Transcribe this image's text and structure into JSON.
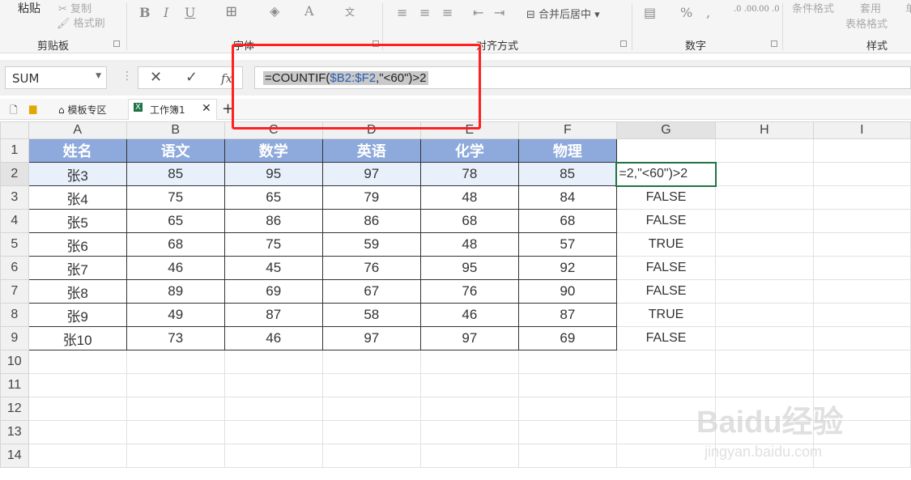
{
  "ribbon": {
    "paste": "粘贴",
    "copy": "复制",
    "format_painter": "格式刷",
    "merge_center": "合并后居中",
    "cond_format": "条件格式",
    "apply_table": "套用",
    "table_format": "表格格式",
    "single": "单",
    "groups": {
      "clipboard": "剪贴板",
      "font": "字体",
      "alignment": "对齐方式",
      "number": "数字",
      "styles": "样式"
    }
  },
  "formula_bar": {
    "name_box": "SUM",
    "formula_prefix": "=COUNTIF(",
    "formula_ref": "$B2:$F2",
    "formula_suffix": ",\"<60\")>2"
  },
  "tabs": {
    "template_zone": "模板专区",
    "workbook": "工作簿1",
    "add": "+"
  },
  "columns": [
    "A",
    "B",
    "C",
    "D",
    "E",
    "F",
    "G",
    "H",
    "I"
  ],
  "rows": [
    "1",
    "2",
    "3",
    "4",
    "5",
    "6",
    "7",
    "8",
    "9",
    "10",
    "11",
    "12",
    "13",
    "14"
  ],
  "table_headers": [
    "姓名",
    "语文",
    "数学",
    "英语",
    "化学",
    "物理"
  ],
  "table_rows": [
    {
      "name": "张3",
      "scores": [
        "85",
        "95",
        "97",
        "78",
        "85"
      ],
      "g": "=2,\"<60\")>2"
    },
    {
      "name": "张4",
      "scores": [
        "75",
        "65",
        "79",
        "48",
        "84"
      ],
      "g": "FALSE"
    },
    {
      "name": "张5",
      "scores": [
        "65",
        "86",
        "86",
        "68",
        "68"
      ],
      "g": "FALSE"
    },
    {
      "name": "张6",
      "scores": [
        "68",
        "75",
        "59",
        "48",
        "57"
      ],
      "g": "TRUE"
    },
    {
      "name": "张7",
      "scores": [
        "46",
        "45",
        "76",
        "95",
        "92"
      ],
      "g": "FALSE"
    },
    {
      "name": "张8",
      "scores": [
        "89",
        "69",
        "67",
        "76",
        "90"
      ],
      "g": "FALSE"
    },
    {
      "name": "张9",
      "scores": [
        "49",
        "87",
        "58",
        "46",
        "87"
      ],
      "g": "TRUE"
    },
    {
      "name": "张10",
      "scores": [
        "73",
        "46",
        "97",
        "97",
        "69"
      ],
      "g": "FALSE"
    }
  ],
  "watermark": {
    "brand": "Baidu经验",
    "url": "jingyan.baidu.com"
  },
  "colors": {
    "header_fill": "#8ea9db",
    "annotation": "#ff2020",
    "active_border": "#217346"
  }
}
